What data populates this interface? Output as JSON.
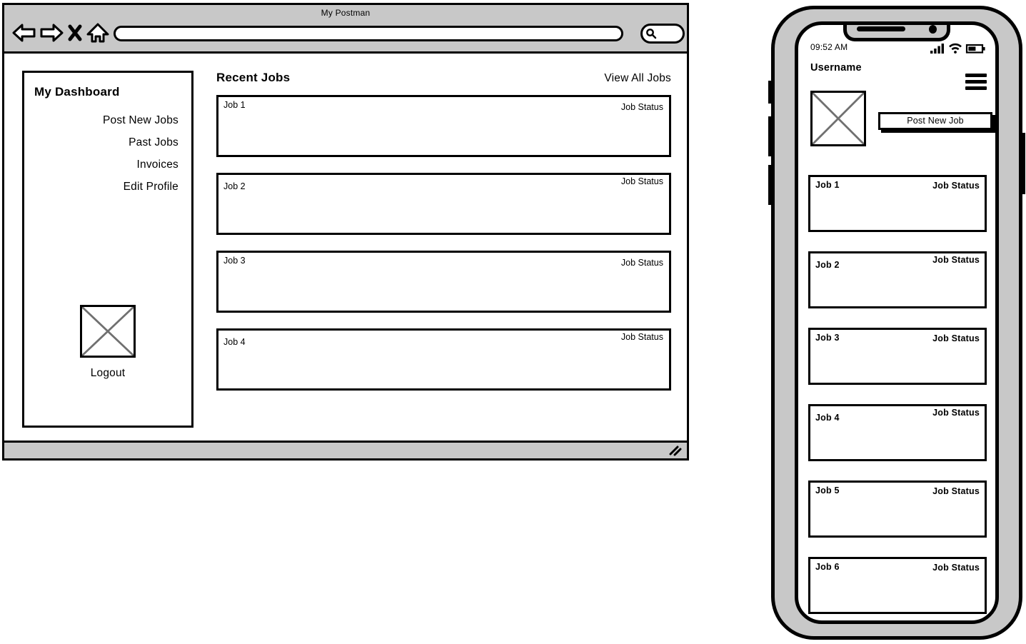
{
  "desktop": {
    "window_title": "My Postman",
    "toolbar": {
      "back_icon": "arrow-left-icon",
      "forward_icon": "arrow-right-icon",
      "stop_icon": "close-x-icon",
      "home_icon": "home-icon",
      "url_value": "",
      "url_placeholder": "",
      "search_value": "",
      "search_icon": "magnifier-icon"
    },
    "sidebar": {
      "title": "My Dashboard",
      "items": [
        {
          "label": "Post New Jobs"
        },
        {
          "label": "Past Jobs"
        },
        {
          "label": "Invoices"
        },
        {
          "label": "Edit Profile"
        }
      ],
      "avatar_icon": "image-placeholder-icon",
      "logout_label": "Logout"
    },
    "main": {
      "heading": "Recent Jobs",
      "view_all_label": "View All Jobs",
      "jobs": [
        {
          "name": "Job 1",
          "status": "Job Status"
        },
        {
          "name": "Job 2",
          "status": "Job Status"
        },
        {
          "name": "Job 3",
          "status": "Job Status"
        },
        {
          "name": "Job 4",
          "status": "Job Status"
        }
      ]
    },
    "status_bar": {
      "resize_icon": "resize-grip-icon"
    }
  },
  "phone": {
    "status": {
      "time": "09:52 AM",
      "signal_icon": "cellular-signal-icon",
      "wifi_icon": "wifi-icon",
      "battery_icon": "battery-icon"
    },
    "menu_icon": "hamburger-menu-icon",
    "username": "Username",
    "avatar_icon": "image-placeholder-icon",
    "post_new_job_label": "Post New Job",
    "jobs": [
      {
        "name": "Job 1",
        "status": "Job Status"
      },
      {
        "name": "Job 2",
        "status": "Job Status"
      },
      {
        "name": "Job 3",
        "status": "Job Status"
      },
      {
        "name": "Job 4",
        "status": "Job Status"
      },
      {
        "name": "Job 5",
        "status": "Job Status"
      },
      {
        "name": "Job 6",
        "status": "Job Status"
      }
    ]
  },
  "colors": {
    "chrome_grey": "#c8c8c8",
    "stroke": "#000000",
    "placeholder_line": "#707070"
  }
}
